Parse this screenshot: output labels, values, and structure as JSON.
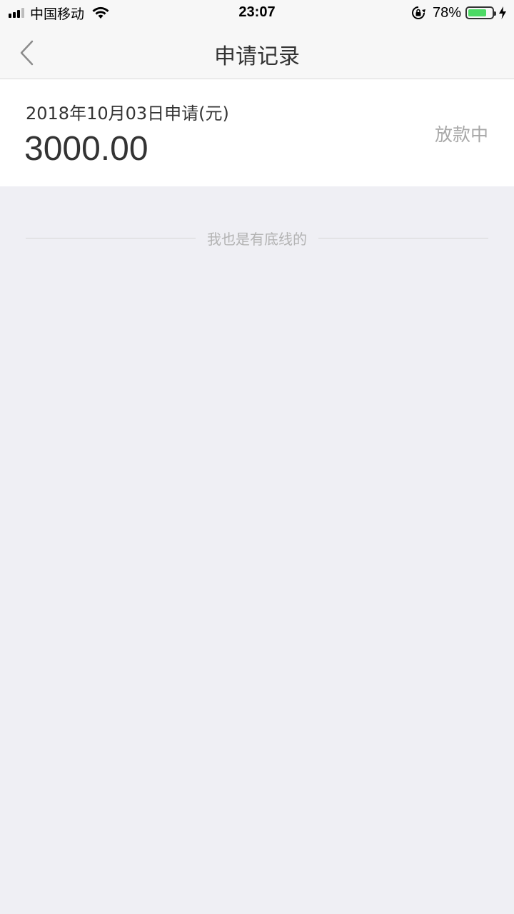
{
  "status_bar": {
    "carrier": "中国移动",
    "time": "23:07",
    "battery_percent": "78%",
    "battery_level": 0.78,
    "battery_color": "#4cd964",
    "icons": [
      "signal-icon",
      "wifi-icon",
      "rotation-lock-icon",
      "battery-icon",
      "charging-icon"
    ]
  },
  "nav": {
    "title": "申请记录",
    "back_icon": "chevron-left-icon"
  },
  "records": [
    {
      "date_label": "2018年10月03日申请(元)",
      "amount": "3000.00",
      "status": "放款中"
    }
  ],
  "footer": {
    "end_text": "我也是有底线的"
  },
  "colors": {
    "background": "#efeff4",
    "card": "#ffffff",
    "status_text": "#a8a8a8",
    "divider": "#d6d6d6"
  }
}
